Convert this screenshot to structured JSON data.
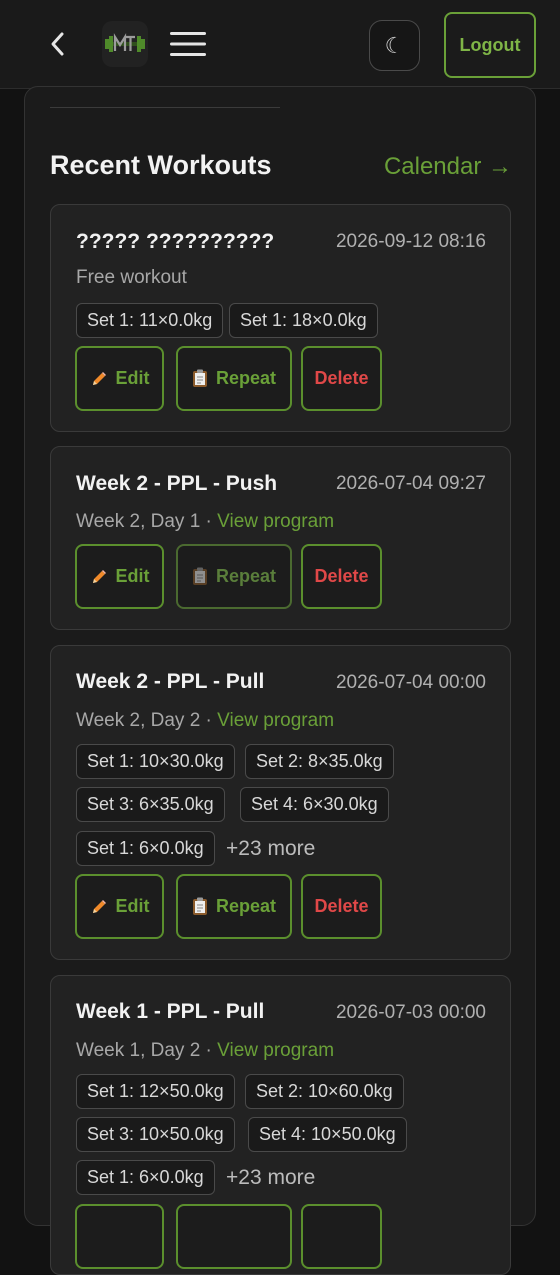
{
  "header": {
    "logout_label": "Logout",
    "theme_glyph": "☾",
    "icons": {
      "back": "chevron-left-icon",
      "menu": "hamburger-menu-icon",
      "theme": "moon-icon"
    }
  },
  "section": {
    "title": "Recent Workouts",
    "calendar_link": "Calendar →"
  },
  "actions": {
    "edit": "Edit",
    "repeat": "Repeat",
    "delete": "Delete"
  },
  "workouts": [
    {
      "title": "????? ??????????",
      "date": "2026-09-12 08:16",
      "subtitle": "Free workout",
      "sets": [
        "Set 1: 11×0.0kg",
        "Set 1: 18×0.0kg"
      ]
    },
    {
      "title": "Week 2 - PPL - Push",
      "date": "2026-07-04 09:27",
      "subtitle": "Week 2, Day 1 · ",
      "program_link": "View program",
      "sets": []
    },
    {
      "title": "Week 2 - PPL - Pull",
      "date": "2026-07-04 00:00",
      "subtitle": "Week 2, Day 2 · ",
      "program_link": "View program",
      "sets": [
        "Set 1: 10×30.0kg",
        "Set 2: 8×35.0kg",
        "Set 3: 6×35.0kg",
        "Set 4: 6×30.0kg",
        "Set 1: 6×0.0kg"
      ],
      "more": "+23 more"
    },
    {
      "title": "Week 1 - PPL - Pull",
      "date": "2026-07-03 00:00",
      "subtitle": "Week 1, Day 2 · ",
      "program_link": "View program",
      "sets": [
        "Set 1: 12×50.0kg",
        "Set 2: 10×60.0kg",
        "Set 3: 10×50.0kg",
        "Set 4: 10×50.0kg",
        "Set 1: 6×0.0kg"
      ],
      "more": "+23 more"
    }
  ],
  "colors": {
    "accent": "#6aa038",
    "danger": "#e04848",
    "background": "#121212",
    "card": "#222222"
  }
}
